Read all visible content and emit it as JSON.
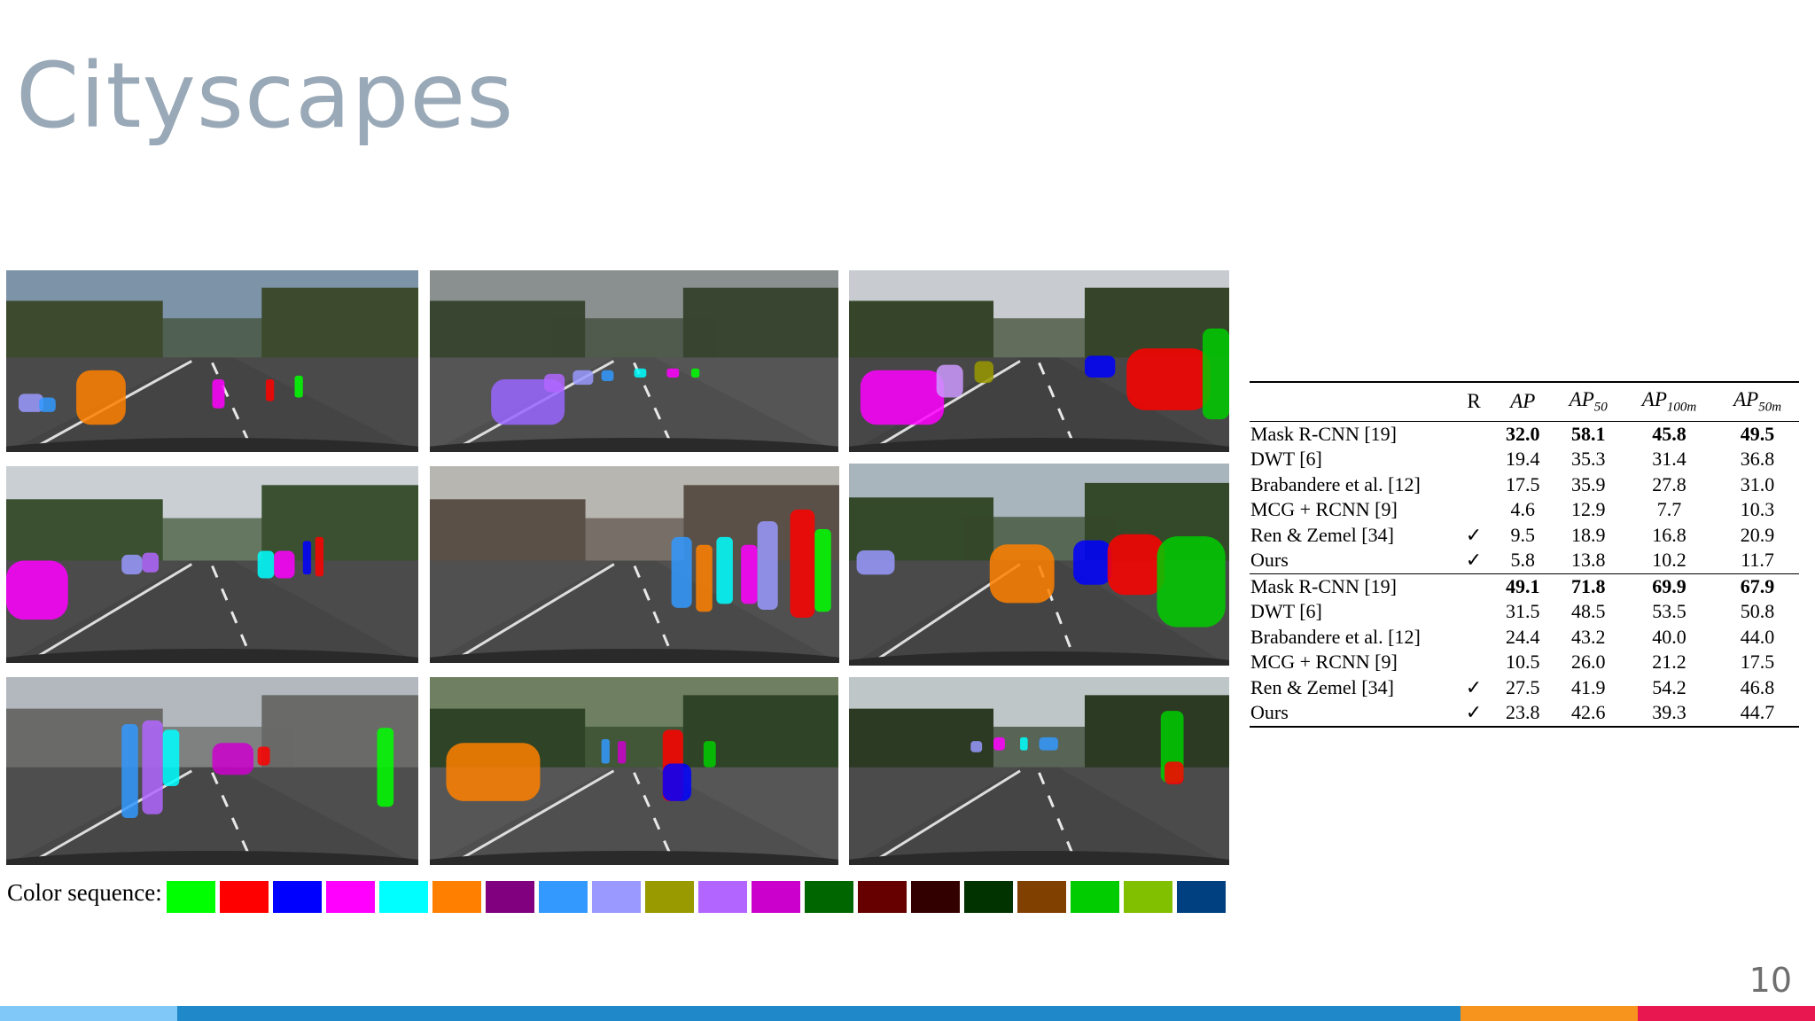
{
  "slide": {
    "title": "Cityscapes",
    "page_number": "10"
  },
  "images": [
    {
      "name": "scene-1",
      "sky": "#7d93a8",
      "ground": "#4a4a4a",
      "trees": "#3d4a2e"
    },
    {
      "name": "scene-2",
      "sky": "#8a8f90",
      "ground": "#555555",
      "trees": "#394530"
    },
    {
      "name": "scene-3",
      "sky": "#c8ccd0",
      "ground": "#474747",
      "trees": "#36452a"
    },
    {
      "name": "scene-4",
      "sky": "#c9cfd2",
      "ground": "#4b4b4b",
      "trees": "#3a5030"
    },
    {
      "name": "scene-5",
      "sky": "#b8b6b0",
      "ground": "#505050",
      "trees": "#5a5048"
    },
    {
      "name": "scene-6",
      "sky": "#a9b5bc",
      "ground": "#4a4a4a",
      "trees": "#34482a"
    },
    {
      "name": "scene-7",
      "sky": "#b2b8bd",
      "ground": "#4e4e4e",
      "trees": "#6a6a68"
    },
    {
      "name": "scene-8",
      "sky": "#6e7f62",
      "ground": "#565656",
      "trees": "#2f4426"
    },
    {
      "name": "scene-9",
      "sky": "#bfc6c8",
      "ground": "#4b4b4b",
      "trees": "#2c3a24"
    }
  ],
  "color_sequence": {
    "label": "Color sequence:",
    "colors": [
      "#00ff00",
      "#ff0000",
      "#0000ff",
      "#ff00ff",
      "#00ffff",
      "#ff8000",
      "#800080",
      "#3399ff",
      "#9999ff",
      "#999900",
      "#b266ff",
      "#cc00cc",
      "#006600",
      "#660000",
      "#330000",
      "#003300",
      "#804000",
      "#00cc00",
      "#80c000",
      "#004080"
    ]
  },
  "table": {
    "headers": [
      "",
      "R",
      "AP",
      "AP50",
      "AP100m",
      "AP50m"
    ],
    "header_base": [
      "",
      "R",
      "AP",
      "AP",
      "AP",
      "AP"
    ],
    "header_sub": [
      "",
      "",
      "",
      "50",
      "100m",
      "50m"
    ],
    "group1": [
      {
        "method": "Mask R-CNN [19]",
        "r": "",
        "ap": "32.0",
        "ap50": "58.1",
        "ap100m": "45.8",
        "ap50m": "49.5",
        "bold": true
      },
      {
        "method": "DWT [6]",
        "r": "",
        "ap": "19.4",
        "ap50": "35.3",
        "ap100m": "31.4",
        "ap50m": "36.8",
        "bold": false
      },
      {
        "method": "Brabandere et al. [12]",
        "r": "",
        "ap": "17.5",
        "ap50": "35.9",
        "ap100m": "27.8",
        "ap50m": "31.0",
        "bold": false
      },
      {
        "method": "MCG + RCNN [9]",
        "r": "",
        "ap": "4.6",
        "ap50": "12.9",
        "ap100m": "7.7",
        "ap50m": "10.3",
        "bold": false
      },
      {
        "method": "Ren & Zemel [34]",
        "r": "✓",
        "ap": "9.5",
        "ap50": "18.9",
        "ap100m": "16.8",
        "ap50m": "20.9",
        "bold": false
      },
      {
        "method": "Ours",
        "r": "✓",
        "ap": "5.8",
        "ap50": "13.8",
        "ap100m": "10.2",
        "ap50m": "11.7",
        "bold": false
      }
    ],
    "group2": [
      {
        "method": "Mask R-CNN [19]",
        "r": "",
        "ap": "49.1",
        "ap50": "71.8",
        "ap100m": "69.9",
        "ap50m": "67.9",
        "bold": true
      },
      {
        "method": "DWT [6]",
        "r": "",
        "ap": "31.5",
        "ap50": "48.5",
        "ap100m": "53.5",
        "ap50m": "50.8",
        "bold": false
      },
      {
        "method": "Brabandere et al. [12]",
        "r": "",
        "ap": "24.4",
        "ap50": "43.2",
        "ap100m": "40.0",
        "ap50m": "44.0",
        "bold": false
      },
      {
        "method": "MCG + RCNN [9]",
        "r": "",
        "ap": "10.5",
        "ap50": "26.0",
        "ap100m": "21.2",
        "ap50m": "17.5",
        "bold": false
      },
      {
        "method": "Ren & Zemel [34]",
        "r": "✓",
        "ap": "27.5",
        "ap50": "41.9",
        "ap100m": "54.2",
        "ap50m": "46.8",
        "bold": false
      },
      {
        "method": "Ours",
        "r": "✓",
        "ap": "23.8",
        "ap50": "42.6",
        "ap100m": "39.3",
        "ap50m": "44.7",
        "bold": false
      }
    ]
  },
  "footer": {
    "colors": [
      "#7fc8f8",
      "#1e88c8",
      "#f7941d",
      "#e8174f"
    ]
  }
}
